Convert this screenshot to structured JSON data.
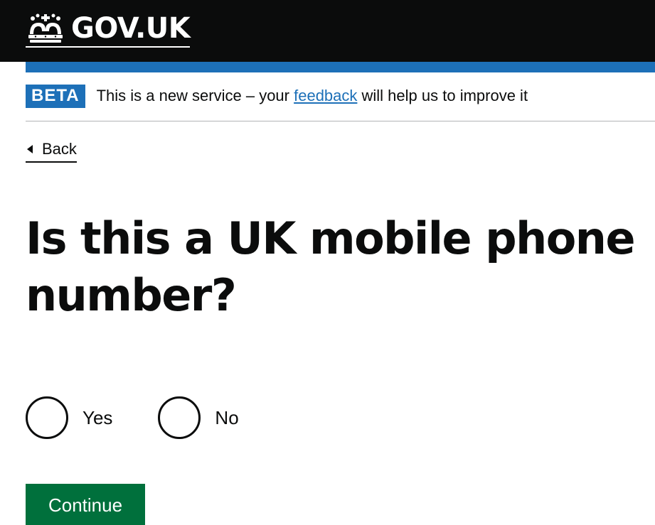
{
  "header": {
    "logo_text": "GOV.UK",
    "logo_icon": "crown-icon",
    "background_color": "#0b0c0c",
    "accent_color": "#1d70b8"
  },
  "phase_banner": {
    "tag": "BETA",
    "text_before": "This is a new service – your ",
    "link_text": "feedback",
    "text_after": " will help us to improve it"
  },
  "back_link": {
    "label": "Back",
    "icon": "triangle-left-icon"
  },
  "question": {
    "title": "Is this a UK mobile phone number?"
  },
  "radios": {
    "options": [
      {
        "label": "Yes",
        "checked": false
      },
      {
        "label": "No",
        "checked": false
      }
    ]
  },
  "actions": {
    "continue_label": "Continue",
    "button_color": "#00703c"
  }
}
